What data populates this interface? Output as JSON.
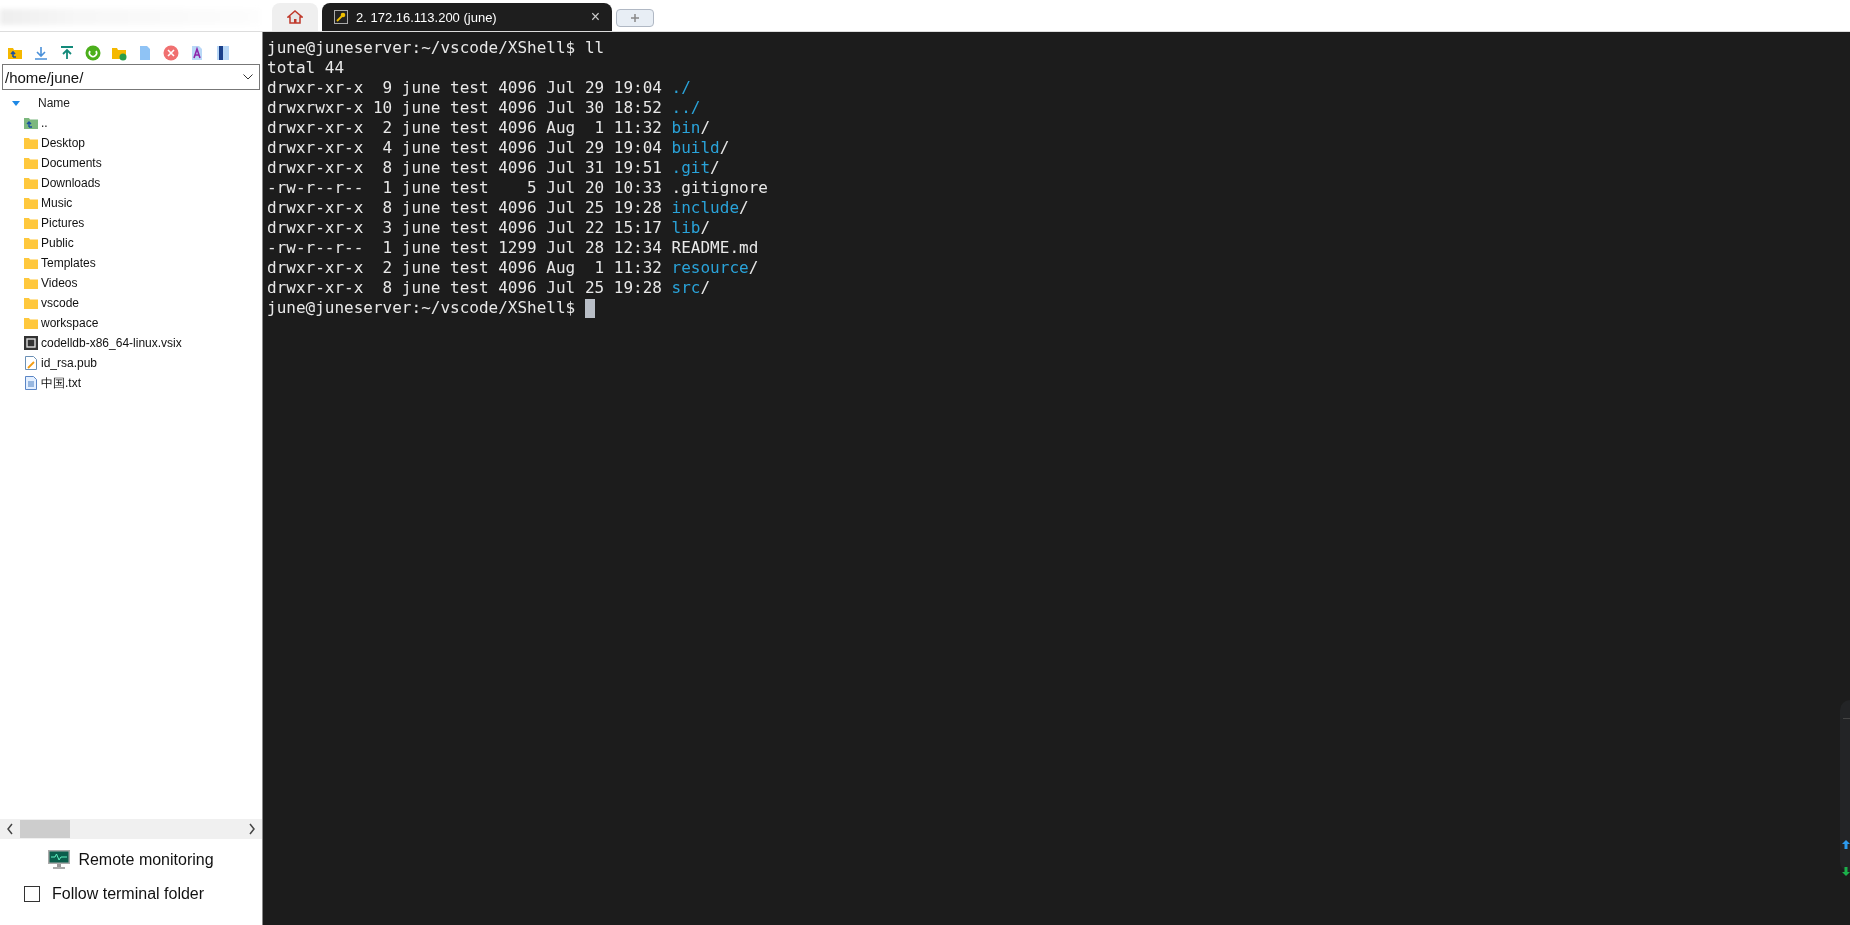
{
  "tabs": [
    {
      "kind": "home",
      "selected": false
    },
    {
      "kind": "session",
      "label": "2. 172.16.113.200 (june)",
      "close": "×",
      "selected": true
    },
    {
      "kind": "new",
      "selected": false
    }
  ],
  "file_panel": {
    "path": "/home/june/",
    "column": "Name",
    "items": [
      {
        "kind": "up",
        "name": ".."
      },
      {
        "kind": "folder",
        "name": "Desktop"
      },
      {
        "kind": "folder",
        "name": "Documents"
      },
      {
        "kind": "folder",
        "name": "Downloads"
      },
      {
        "kind": "folder",
        "name": "Music"
      },
      {
        "kind": "folder",
        "name": "Pictures"
      },
      {
        "kind": "folder",
        "name": "Public"
      },
      {
        "kind": "folder",
        "name": "Templates"
      },
      {
        "kind": "folder",
        "name": "Videos"
      },
      {
        "kind": "folder",
        "name": "vscode"
      },
      {
        "kind": "folder",
        "name": "workspace"
      },
      {
        "kind": "package",
        "name": "codelldb-x86_64-linux.vsix"
      },
      {
        "kind": "edit",
        "name": "id_rsa.pub"
      },
      {
        "kind": "text",
        "name": "中国.txt"
      }
    ],
    "remote_monitoring": "Remote monitoring",
    "follow_folder": {
      "label": "Follow terminal folder",
      "checked": false
    }
  },
  "terminal": {
    "lines": [
      {
        "kind": "plain",
        "text": "june@juneserver:~/vscode/XShell$ ll"
      },
      {
        "kind": "plain",
        "text": "total 44"
      },
      {
        "kind": "entry",
        "info": "drwxr-xr-x  9 june test 4096 Jul 29 19:04 ",
        "name": "./",
        "dir": true
      },
      {
        "kind": "entry",
        "info": "drwxrwxr-x 10 june test 4096 Jul 30 18:52 ",
        "name": "../",
        "dir": true
      },
      {
        "kind": "entry",
        "info": "drwxr-xr-x  2 june test 4096 Aug  1 11:32 ",
        "name": "bin",
        "suffix": "/",
        "dir": true
      },
      {
        "kind": "entry",
        "info": "drwxr-xr-x  4 june test 4096 Jul 29 19:04 ",
        "name": "build",
        "suffix": "/",
        "dir": true
      },
      {
        "kind": "entry",
        "info": "drwxr-xr-x  8 june test 4096 Jul 31 19:51 ",
        "name": ".git",
        "suffix": "/",
        "dir": true
      },
      {
        "kind": "entry",
        "info": "-rw-r--r--  1 june test    5 Jul 20 10:33 ",
        "name": ".gitignore",
        "dir": false
      },
      {
        "kind": "entry",
        "info": "drwxr-xr-x  8 june test 4096 Jul 25 19:28 ",
        "name": "include",
        "suffix": "/",
        "dir": true
      },
      {
        "kind": "entry",
        "info": "drwxr-xr-x  3 june test 4096 Jul 22 15:17 ",
        "name": "lib",
        "suffix": "/",
        "dir": true
      },
      {
        "kind": "entry",
        "info": "-rw-r--r--  1 june test 1299 Jul 28 12:34 ",
        "name": "README.md",
        "dir": false
      },
      {
        "kind": "entry",
        "info": "drwxr-xr-x  2 june test 4096 Aug  1 11:32 ",
        "name": "resource",
        "suffix": "/",
        "dir": true
      },
      {
        "kind": "entry",
        "info": "drwxr-xr-x  8 june test 4096 Jul 25 19:28 ",
        "name": "src",
        "suffix": "/",
        "dir": true
      },
      {
        "kind": "prompt",
        "text": "june@juneserver:~/vscode/XShell$ "
      }
    ]
  }
}
